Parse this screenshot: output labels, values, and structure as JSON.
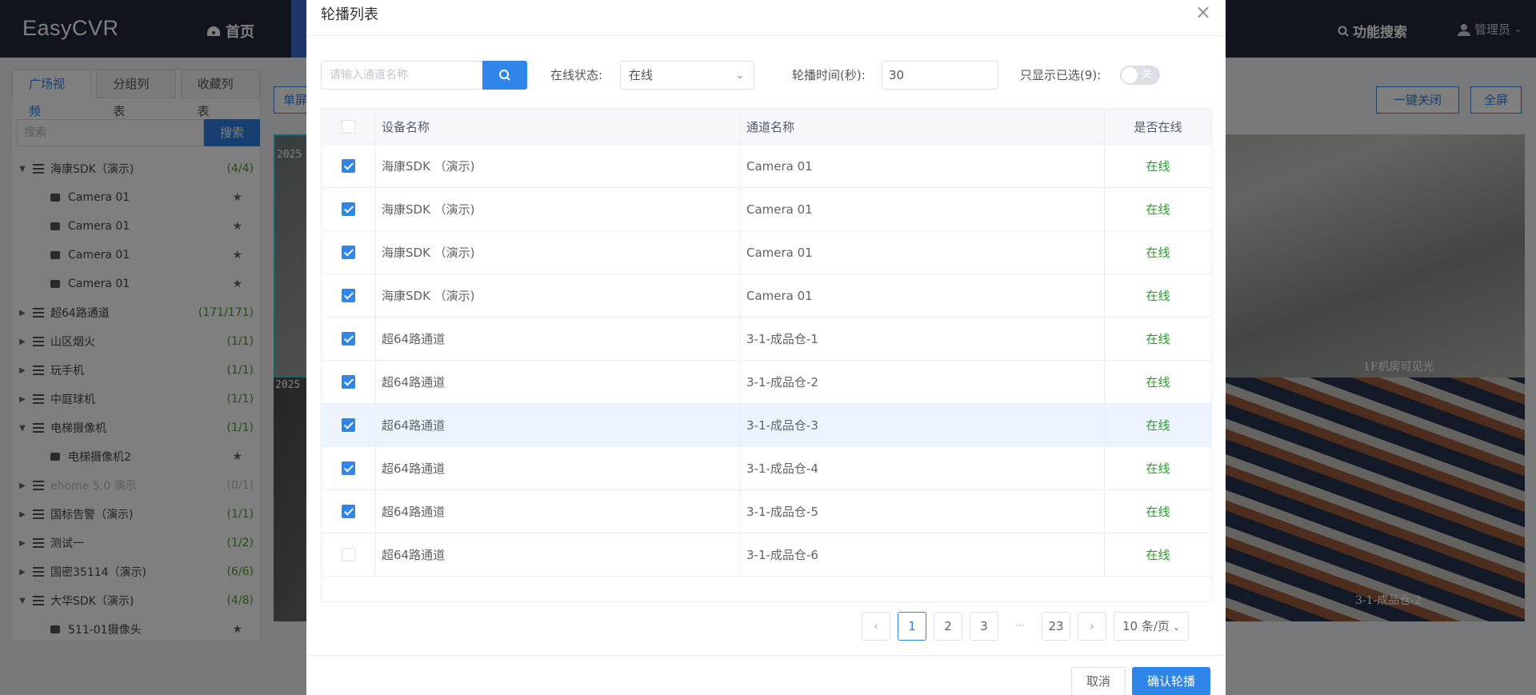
{
  "app": {
    "logo": "EasyCVR",
    "nav_home": "首页",
    "nav_search": "功能搜索",
    "nav_user": "管理员"
  },
  "left": {
    "tabs": [
      "广场视频",
      "分组列表",
      "收藏列表"
    ],
    "search_placeholder": "搜索",
    "search_button": "搜索",
    "tree": [
      {
        "label": "海康SDK（演示)",
        "count": "(4/4)",
        "expanded": true
      },
      {
        "label": "Camera 01",
        "child": true
      },
      {
        "label": "Camera 01",
        "child": true
      },
      {
        "label": "Camera 01",
        "child": true
      },
      {
        "label": "Camera 01",
        "child": true
      },
      {
        "label": "超64路通道",
        "count": "(171/171)"
      },
      {
        "label": "山区烟火",
        "count": "(1/1)"
      },
      {
        "label": "玩手机",
        "count": "(1/1)"
      },
      {
        "label": "中庭球机",
        "count": "(1/1)"
      },
      {
        "label": "电梯摄像机",
        "count": "(1/1)",
        "expanded": true
      },
      {
        "label": "电梯摄像机2",
        "child": true
      },
      {
        "label": "ehome 5.0 演示",
        "count": "(0/1)",
        "disabled": true
      },
      {
        "label": "国标告警（演示)",
        "count": "(1/1)"
      },
      {
        "label": "测试一",
        "count": "(1/2)"
      },
      {
        "label": "国密35114（演示)",
        "count": "(6/6)"
      },
      {
        "label": "大华SDK（演示)",
        "count": "(4/8)",
        "expanded": true
      },
      {
        "label": "511-01摄像头",
        "child": true
      }
    ]
  },
  "toolbar": {
    "single": "单屏",
    "close_all": "一键关闭",
    "fullscreen": "全屏"
  },
  "videos": {
    "v1_time": "2025",
    "v3_time": "2025",
    "v2_osd": "1F机房可见光",
    "v4_osd": "3-1-成品仓-2"
  },
  "modal": {
    "title": "轮播列表",
    "search_placeholder": "请输入通道名称",
    "status_label": "在线状态:",
    "status_value": "在线",
    "interval_label": "轮播时间(秒):",
    "interval_value": "30",
    "only_selected_label": "只显示已选(9):",
    "toggle_label": "关",
    "columns": [
      "设备名称",
      "通道名称",
      "是否在线"
    ],
    "rows": [
      {
        "checked": true,
        "device": "海康SDK （演示)",
        "channel": "Camera 01",
        "status": "在线"
      },
      {
        "checked": true,
        "device": "海康SDK （演示)",
        "channel": "Camera 01",
        "status": "在线"
      },
      {
        "checked": true,
        "device": "海康SDK （演示)",
        "channel": "Camera 01",
        "status": "在线"
      },
      {
        "checked": true,
        "device": "海康SDK （演示)",
        "channel": "Camera 01",
        "status": "在线"
      },
      {
        "checked": true,
        "device": "超64路通道",
        "channel": "3-1-成品仓-1",
        "status": "在线"
      },
      {
        "checked": true,
        "device": "超64路通道",
        "channel": "3-1-成品仓-2",
        "status": "在线"
      },
      {
        "checked": true,
        "device": "超64路通道",
        "channel": "3-1-成品仓-3",
        "status": "在线",
        "highlight": true
      },
      {
        "checked": true,
        "device": "超64路通道",
        "channel": "3-1-成品仓-4",
        "status": "在线"
      },
      {
        "checked": true,
        "device": "超64路通道",
        "channel": "3-1-成品仓-5",
        "status": "在线"
      },
      {
        "checked": false,
        "device": "超64路通道",
        "channel": "3-1-成品仓-6",
        "status": "在线"
      }
    ],
    "pagination": {
      "prev": "‹",
      "pages": [
        "1",
        "2",
        "3"
      ],
      "current": "1",
      "ellipsis": "···",
      "last": "23",
      "next": "›",
      "page_size": "10 条/页"
    },
    "cancel": "取消",
    "confirm": "确认轮播"
  },
  "colors": {
    "topbar": "#20293b",
    "primary": "#2f86e8",
    "online": "#2a9a2a"
  }
}
